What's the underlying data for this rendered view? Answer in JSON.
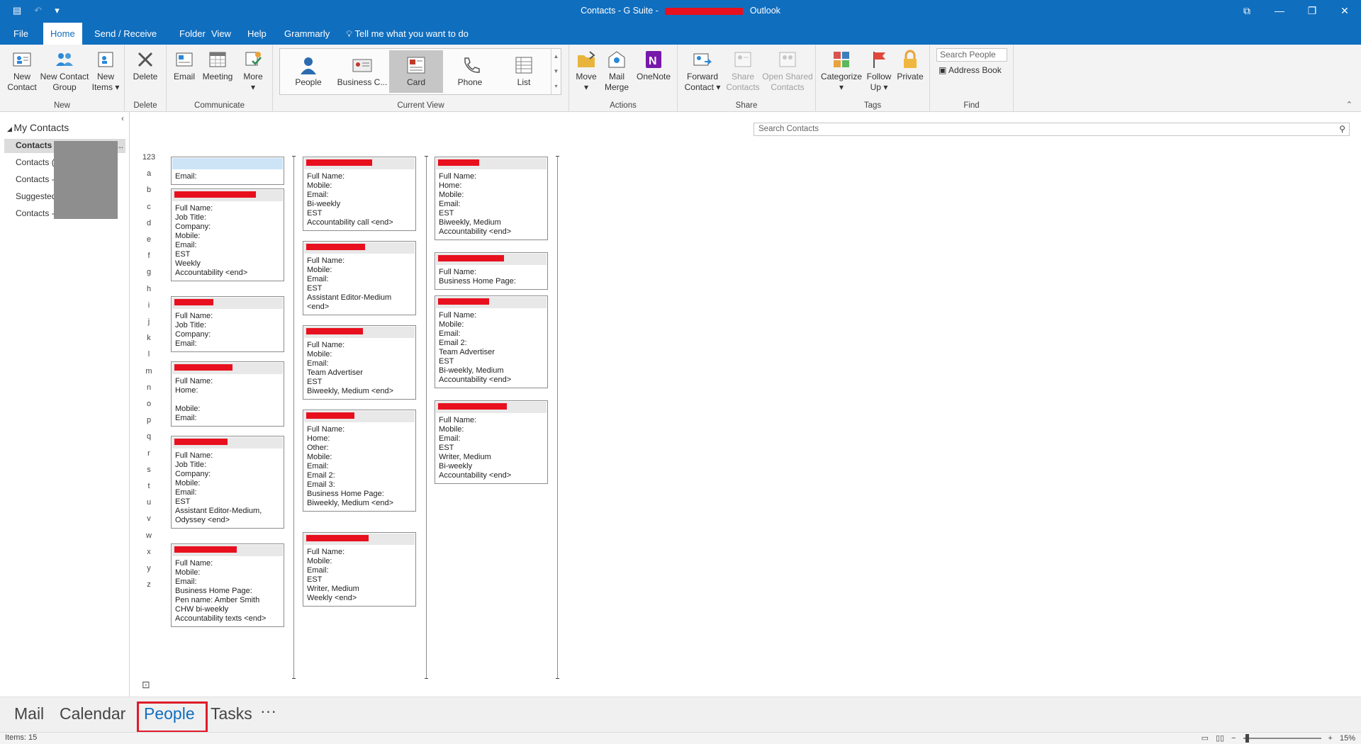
{
  "titlebar": {
    "title_prefix": "Contacts - G Suite -",
    "title_suffix": "Outlook",
    "restore_icon": "⧉",
    "minimize_icon": "—",
    "maximize_icon": "❐",
    "close_icon": "✕"
  },
  "menu": {
    "file": "File",
    "tabs": [
      "Home",
      "Send / Receive",
      "Folder",
      "View",
      "Help",
      "Grammarly"
    ],
    "tell_me": "Tell me what you want to do"
  },
  "ribbon": {
    "new_group": {
      "label": "New",
      "new_contact": "New\nContact",
      "new_contact_group": "New Contact\nGroup",
      "new_items": "New\nItems ▾"
    },
    "delete_group": {
      "label": "Delete",
      "delete": "Delete"
    },
    "communicate_group": {
      "label": "Communicate",
      "email": "Email",
      "meeting": "Meeting",
      "more": "More\n▾"
    },
    "current_view": {
      "label": "Current View",
      "people": "People",
      "business_card": "Business C...",
      "card": "Card",
      "phone": "Phone",
      "list": "List"
    },
    "actions_group": {
      "label": "Actions",
      "move": "Move\n▾",
      "mail_merge": "Mail\nMerge",
      "onenote": "OneNote"
    },
    "share_group": {
      "label": "Share",
      "forward_contact": "Forward\nContact ▾",
      "share_contacts": "Share\nContacts",
      "open_shared": "Open Shared\nContacts"
    },
    "tags_group": {
      "label": "Tags",
      "categorize": "Categorize\n▾",
      "follow_up": "Follow\nUp ▾",
      "private": "Private"
    },
    "find_group": {
      "label": "Find",
      "search_people": "Search People",
      "address_book": "Address Book"
    }
  },
  "left_pane": {
    "header": "My Contacts",
    "items": [
      "Contacts -",
      "Contacts (",
      "Contacts -",
      "Suggested",
      "Contacts -"
    ],
    "ellipsis": "..."
  },
  "search_contacts": {
    "placeholder": "Search Contacts"
  },
  "alphabet": [
    "123",
    "a",
    "b",
    "c",
    "d",
    "e",
    "f",
    "g",
    "h",
    "i",
    "j",
    "k",
    "l",
    "m",
    "n",
    "o",
    "p",
    "q",
    "r",
    "s",
    "t",
    "u",
    "v",
    "w",
    "x",
    "y",
    "z"
  ],
  "cards": [
    {
      "lines": [
        "Email:"
      ]
    },
    {
      "lines": [
        "Full Name:",
        "Job Title:",
        "Company:",
        "Mobile:",
        "Email:",
        "EST",
        "Weekly",
        "Accountability <end>"
      ]
    },
    {
      "lines": [
        "Full Name:",
        "Job Title:",
        "Company:",
        "Email:"
      ]
    },
    {
      "lines": [
        "Full Name:",
        "Home:",
        "",
        "Mobile:",
        "Email:"
      ]
    },
    {
      "lines": [
        "Full Name:",
        "Job Title:",
        "Company:",
        "Mobile:",
        "Email:",
        "EST",
        "Assistant Editor-Medium,",
        "Odyssey <end>"
      ]
    },
    {
      "lines": [
        "Full Name:",
        "Mobile:",
        "Email:",
        "Business Home Page:",
        "Pen name: Amber Smith",
        "CHW bi-weekly",
        "Accountability texts <end>"
      ]
    },
    {
      "lines": [
        "Full Name:",
        "Mobile:",
        "Email:",
        "Bi-weekly",
        "EST",
        "Accountability call <end>"
      ]
    },
    {
      "lines": [
        "Full Name:",
        "Mobile:",
        "Email:",
        "EST",
        "Assistant Editor-Medium",
        "<end>"
      ]
    },
    {
      "lines": [
        "Full Name:",
        "Mobile:",
        "Email:",
        "Team Advertiser",
        "EST",
        "Biweekly, Medium <end>"
      ]
    },
    {
      "lines": [
        "Full Name:",
        "Home:",
        "Other:",
        "Mobile:",
        "Email:",
        "Email 2:",
        "Email 3:",
        "Business Home Page:",
        "Biweekly, Medium <end>"
      ]
    },
    {
      "lines": [
        "Full Name:",
        "Mobile:",
        "Email:",
        "EST",
        "Writer, Medium",
        "Weekly <end>"
      ]
    },
    {
      "lines": [
        "Full Name:",
        "Home:",
        "Mobile:",
        "Email:",
        "EST",
        "Biweekly, Medium",
        "Accountability <end>"
      ]
    },
    {
      "lines": [
        "Full Name:",
        "Business Home Page:"
      ]
    },
    {
      "lines": [
        "Full Name:",
        "Mobile:",
        "Email:",
        "Email 2:",
        "Team Advertiser",
        "EST",
        "Bi-weekly, Medium",
        "Accountability <end>"
      ]
    },
    {
      "lines": [
        "Full Name:",
        "Mobile:",
        "Email:",
        "EST",
        "Writer, Medium",
        "Bi-weekly",
        "Accountability <end>"
      ]
    }
  ],
  "bottom_nav": {
    "mail": "Mail",
    "calendar": "Calendar",
    "people": "People",
    "tasks": "Tasks",
    "more": "···"
  },
  "status": {
    "items": "Items: 15",
    "zoom": "15%",
    "zoom_level": 0.15
  }
}
